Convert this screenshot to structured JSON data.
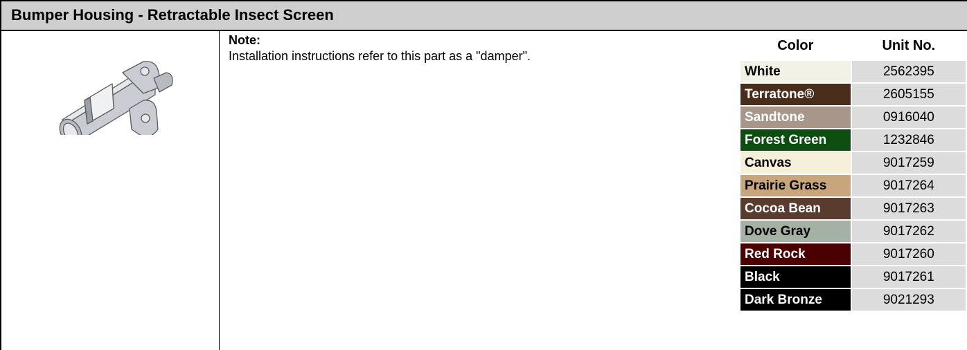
{
  "header": {
    "title": "Bumper Housing - Retractable Insect Screen"
  },
  "note": {
    "label": "Note:",
    "text": "Installation instructions refer to this part as a \"damper\"."
  },
  "part_image": {
    "icon": "bumper-housing-part-image"
  },
  "table": {
    "col_color": "Color",
    "col_unit": "Unit No.",
    "rows": [
      {
        "color": "White",
        "unit": "2562395",
        "bg": "#f1f1e6",
        "fg": "#000000"
      },
      {
        "color": "Terratone®",
        "unit": "2605155",
        "bg": "#4a2c1b",
        "fg": "#ffffff"
      },
      {
        "color": "Sandtone",
        "unit": "0916040",
        "bg": "#a8968a",
        "fg": "#ffffff"
      },
      {
        "color": "Forest Green",
        "unit": "1232846",
        "bg": "#0e4d10",
        "fg": "#ffffff"
      },
      {
        "color": "Canvas",
        "unit": "9017259",
        "bg": "#f6f0d9",
        "fg": "#000000"
      },
      {
        "color": "Prairie Grass",
        "unit": "9017264",
        "bg": "#c9a57b",
        "fg": "#000000"
      },
      {
        "color": "Cocoa Bean",
        "unit": "9017263",
        "bg": "#5a3c2e",
        "fg": "#ffffff"
      },
      {
        "color": "Dove Gray",
        "unit": "9017262",
        "bg": "#a6b1a6",
        "fg": "#000000"
      },
      {
        "color": "Red Rock",
        "unit": "9017260",
        "bg": "#4a0000",
        "fg": "#ffffff"
      },
      {
        "color": "Black",
        "unit": "9017261",
        "bg": "#000000",
        "fg": "#ffffff"
      },
      {
        "color": "Dark Bronze",
        "unit": "9021293",
        "bg": "#000000",
        "fg": "#ffffff"
      }
    ]
  }
}
